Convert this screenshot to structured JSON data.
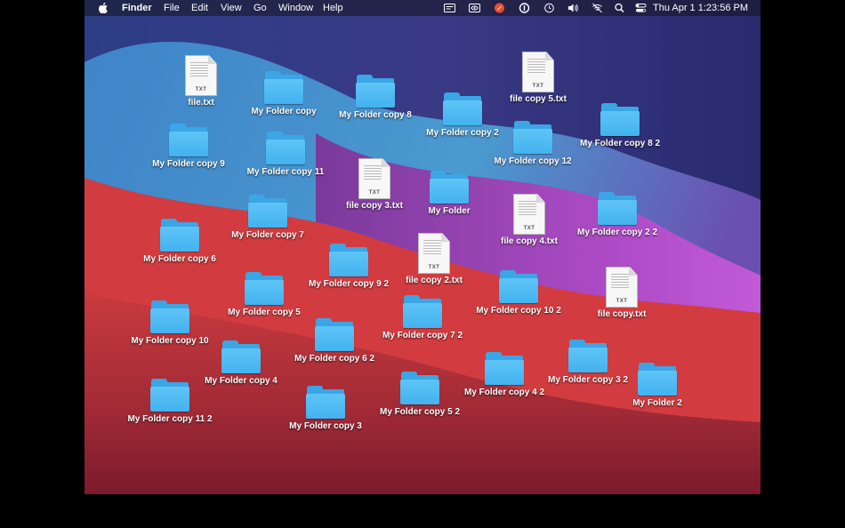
{
  "menubar": {
    "apple_icon": "apple-icon",
    "app_name": "Finder",
    "menus": [
      "File",
      "Edit",
      "View",
      "Go",
      "Window",
      "Help"
    ],
    "tray_icons": [
      "screen-recorder-icon",
      "eye-icon",
      "rocket-app-icon",
      "one-password-icon",
      "time-machine-icon",
      "volume-icon",
      "wifi-off-icon",
      "spotlight-search-icon",
      "control-center-icon"
    ],
    "clock": "Thu Apr 1  1:23:56 PM"
  },
  "desktop": {
    "items": [
      {
        "type": "txt",
        "label": "file.txt",
        "ext": "TXT"
      },
      {
        "type": "folder",
        "label": "My Folder copy"
      },
      {
        "type": "folder",
        "label": "My Folder copy 8"
      },
      {
        "type": "txt",
        "label": "file copy 5.txt",
        "ext": "TXT"
      },
      {
        "type": "folder",
        "label": "My Folder copy 2"
      },
      {
        "type": "folder",
        "label": "My Folder copy 8 2"
      },
      {
        "type": "folder",
        "label": "My Folder copy 9"
      },
      {
        "type": "folder",
        "label": "My Folder copy 11"
      },
      {
        "type": "folder",
        "label": "My Folder copy 12"
      },
      {
        "type": "txt",
        "label": "file copy 3.txt",
        "ext": "TXT"
      },
      {
        "type": "folder",
        "label": "My Folder"
      },
      {
        "type": "txt",
        "label": "file copy 4.txt",
        "ext": "TXT"
      },
      {
        "type": "folder",
        "label": "My Folder copy 2 2"
      },
      {
        "type": "folder",
        "label": "My Folder copy 7"
      },
      {
        "type": "folder",
        "label": "My Folder copy 6"
      },
      {
        "type": "txt",
        "label": "file copy 2.txt",
        "ext": "TXT"
      },
      {
        "type": "folder",
        "label": "My Folder copy 9 2"
      },
      {
        "type": "folder",
        "label": "My Folder copy 5"
      },
      {
        "type": "folder",
        "label": "My Folder copy 10 2"
      },
      {
        "type": "txt",
        "label": "file copy.txt",
        "ext": "TXT"
      },
      {
        "type": "folder",
        "label": "My Folder copy 10"
      },
      {
        "type": "folder",
        "label": "My Folder copy 7 2"
      },
      {
        "type": "folder",
        "label": "My Folder copy 6 2"
      },
      {
        "type": "folder",
        "label": "My Folder copy 4"
      },
      {
        "type": "folder",
        "label": "My Folder copy 3 2"
      },
      {
        "type": "folder",
        "label": "My Folder copy 4 2"
      },
      {
        "type": "folder",
        "label": "My Folder 2"
      },
      {
        "type": "folder",
        "label": "My Folder copy 5 2"
      },
      {
        "type": "folder",
        "label": "My Folder copy 11 2"
      },
      {
        "type": "folder",
        "label": "My Folder copy 3"
      }
    ]
  }
}
